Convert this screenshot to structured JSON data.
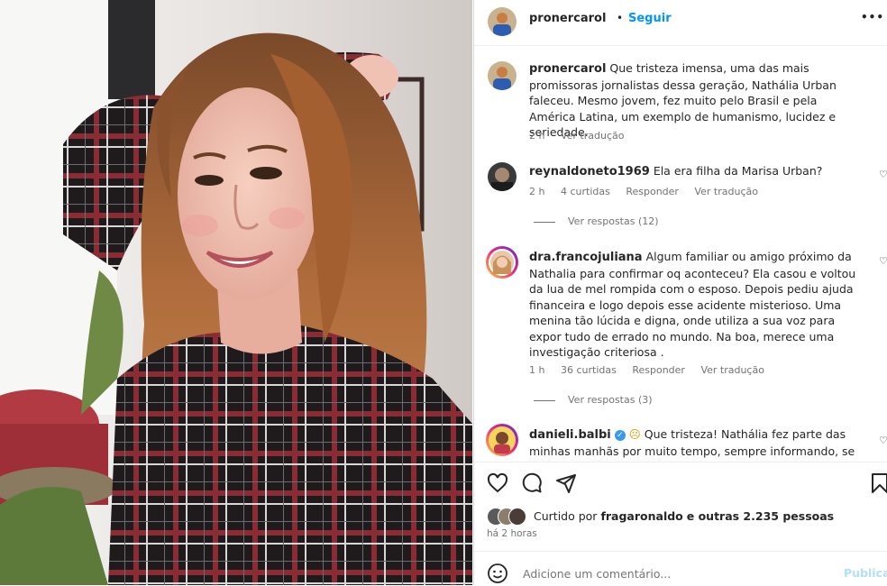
{
  "post": {
    "author": "pronercarol",
    "dot": "•",
    "follow_label": "Seguir",
    "more_icon": "•••"
  },
  "caption": {
    "user": "pronercarol",
    "text": "Que tristeza imensa, uma das mais promissoras jornalistas dessa geração, Nathália Urban faleceu. Mesmo jovem, fez muito pelo Brasil e pela América Latina, um exemplo de humanismo, lucidez e seriedade.",
    "time": "2 h",
    "translate": "Ver tradução"
  },
  "comments": [
    {
      "user": "reynaldoneto1969",
      "text": "Ela era filha da Marisa Urban?",
      "time": "2 h",
      "likes": "4 curtidas",
      "reply": "Responder",
      "translate": "Ver tradução",
      "view_replies": "Ver respostas (12)"
    },
    {
      "user": "dra.francojuliana",
      "text": "Algum familiar ou amigo próximo da Nathalia para confirmar oq aconteceu? Ela casou e voltou da lua de mel rompida com o esposo. Depois pediu ajuda financeira e logo depois esse acidente misterioso. Uma menina tão lúcida e digna, onde utiliza a sua voz para expor tudo de errado no mundo. Na boa, merece uma investigação criteriosa .",
      "time": "1 h",
      "likes": "36 curtidas",
      "reply": "Responder",
      "translate": "Ver tradução",
      "view_replies": "Ver respostas (3)"
    },
    {
      "user": "danieli.balbi",
      "emoji": "☹",
      "text": "Que tristeza! Nathália fez parte das minhas manhãs por muito tempo, sempre informando, se posicionado"
    }
  ],
  "likes_line": {
    "prefix": "Curtido por",
    "user": "fragaronaldo",
    "suffix": "e outras 2.235 pessoas"
  },
  "post_time": "há 2 horas",
  "add_comment": {
    "placeholder": "Adicione um comentário...",
    "publish": "Publicar"
  },
  "colors": {
    "accent": "#0095f6",
    "text": "#262626",
    "muted": "#737373",
    "verified": "#3897f0"
  },
  "icons": [
    "heart-icon",
    "comment-icon",
    "share-icon",
    "bookmark-icon",
    "emoji-icon",
    "more-icon",
    "verified-icon"
  ]
}
